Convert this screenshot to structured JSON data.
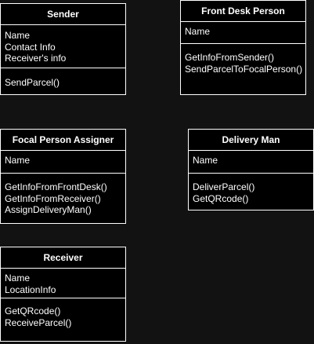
{
  "colors": {
    "background": "#121212",
    "box_fill": "#000000",
    "border": "#ffffff",
    "text": "#ffffff"
  },
  "classes": [
    {
      "name": "Sender",
      "attributes": [
        "Name",
        "Contact Info",
        "Receiver's info"
      ],
      "methods": [
        "SendParcel()"
      ]
    },
    {
      "name": "Front Desk Person",
      "attributes": [
        "Name"
      ],
      "methods": [
        "GetInfoFromSender()",
        "SendParcelToFocalPerson()"
      ]
    },
    {
      "name": "Focal Person Assigner",
      "attributes": [
        "Name"
      ],
      "methods": [
        "GetInfoFromFrontDesk()",
        "GetInfoFromReceiver()",
        "AssignDeliveryMan()"
      ]
    },
    {
      "name": "Delivery Man",
      "attributes": [
        "Name"
      ],
      "methods": [
        "DeliverParcel()",
        "GetQRcode()"
      ]
    },
    {
      "name": "Receiver",
      "attributes": [
        "Name",
        "LocationInfo"
      ],
      "methods": [
        "GetQRcode()",
        "ReceiveParcel()"
      ]
    }
  ]
}
